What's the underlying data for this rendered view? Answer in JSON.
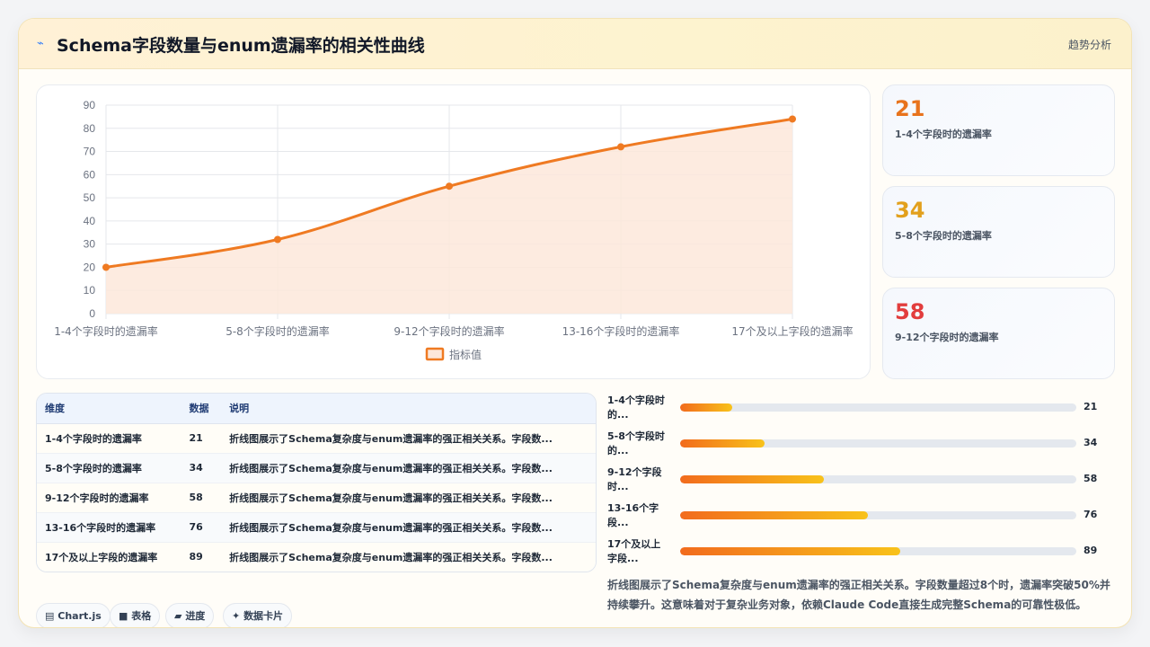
{
  "header": {
    "icon": "trend-line-icon",
    "title": "Schema字段数量与enum遗漏率的相关性曲线",
    "right_label": "趋势分析"
  },
  "chart_data": {
    "type": "line",
    "categories": [
      "1-4个字段时的遗漏率",
      "5-8个字段时的遗漏率",
      "9-12个字段时的遗漏率",
      "13-16个字段时的遗漏率",
      "17个及以上字段的遗漏率"
    ],
    "series": [
      {
        "name": "指标值",
        "values": [
          20,
          32,
          55,
          72,
          84
        ],
        "color": "#ef7a22",
        "fill": "#fde7da"
      }
    ],
    "ylim": [
      0,
      90
    ],
    "yticks": [
      0,
      10,
      20,
      30,
      40,
      50,
      60,
      70,
      80,
      90
    ],
    "grid": true,
    "legend": "bottom"
  },
  "stats": [
    {
      "value": "21",
      "label": "1-4个字段时的遗漏率",
      "color": "#e8731c"
    },
    {
      "value": "34",
      "label": "5-8个字段时的遗漏率",
      "color": "#e2a01c"
    },
    {
      "value": "58",
      "label": "9-12个字段时的遗漏率",
      "color": "#e23d3d"
    }
  ],
  "table": {
    "headers": [
      "维度",
      "数据",
      "说明"
    ],
    "rows": [
      [
        "1-4个字段时的遗漏率",
        "21",
        "折线图展示了Schema复杂度与enum遗漏率的强正相关关系。字段数..."
      ],
      [
        "5-8个字段时的遗漏率",
        "34",
        "折线图展示了Schema复杂度与enum遗漏率的强正相关关系。字段数..."
      ],
      [
        "9-12个字段时的遗漏率",
        "58",
        "折线图展示了Schema复杂度与enum遗漏率的强正相关关系。字段数..."
      ],
      [
        "13-16个字段时的遗漏率",
        "76",
        "折线图展示了Schema复杂度与enum遗漏率的强正相关关系。字段数..."
      ],
      [
        "17个及以上字段的遗漏率",
        "89",
        "折线图展示了Schema复杂度与enum遗漏率的强正相关关系。字段数..."
      ]
    ]
  },
  "progress": [
    {
      "label_line1": "1-4个字段时",
      "label_line2": "的...",
      "value": 21,
      "value_text": "21"
    },
    {
      "label_line1": "5-8个字段时",
      "label_line2": "的...",
      "value": 34,
      "value_text": "34"
    },
    {
      "label_line1": "9-12个字段",
      "label_line2": "时...",
      "value": 58,
      "value_text": "58"
    },
    {
      "label_line1": "13-16个字",
      "label_line2": "段...",
      "value": 76,
      "value_text": "76"
    },
    {
      "label_line1": "17个及以上",
      "label_line2": "字段...",
      "value": 89,
      "value_text": "89"
    }
  ],
  "progress_max": 160,
  "note": "折线图展示了Schema复杂度与enum遗漏率的强正相关关系。字段数量超过8个时，遗漏率突破50%并持续攀升。这意味着对于复杂业务对象，依赖Claude Code直接生成完整Schema的可靠性极低。",
  "chips": [
    {
      "icon": "chart-icon",
      "glyph": "▤",
      "label": "Chart.js"
    },
    {
      "icon": "table-icon",
      "glyph": "■",
      "label": "表格"
    },
    {
      "icon": "progress-icon",
      "glyph": "▰",
      "label": "进度"
    },
    {
      "icon": "sparkle-icon",
      "glyph": "✦",
      "label": "数据卡片"
    }
  ]
}
